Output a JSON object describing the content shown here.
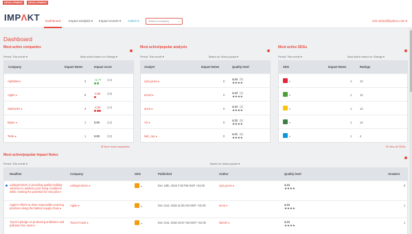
{
  "env": {
    "badge1": "DEVELOPMENT",
    "badge2": "DEVELOPMENT"
  },
  "header": {
    "logo_a": "IMP",
    "logo_b": "Λ",
    "logo_c": "KT",
    "nav": [
      "Dashboard",
      "Impact analysis ▾",
      "Impact scores ▾",
      "Admin ▾"
    ],
    "company_placeholder": "Select a company",
    "user_email": "seb.orlandi@yahoo.com ▾"
  },
  "page_title": "Dashboard",
  "companies": {
    "title": "Most active companies",
    "period": "Period: This month ▾",
    "sort": "Most active based on: Ratings ▾",
    "headers": [
      "Company",
      "Impact Notes",
      "Impact score"
    ],
    "rows": [
      {
        "name": "Alphabet ▾",
        "notes": "3",
        "score": "+1.77",
        "count": "(13)",
        "color": "green",
        "dots": [
          "#4caf50",
          "#4caf50"
        ]
      },
      {
        "name": "Apple ▾",
        "notes": "8",
        "score": "-0.56",
        "count": "(18)",
        "color": "red",
        "dots": [
          "#e53935"
        ]
      },
      {
        "name": "Starbucks ▾",
        "notes": "3",
        "score": "-2.25",
        "count": "(14)",
        "color": "red",
        "dots": [
          "#e53935",
          "#e53935",
          "#e53935"
        ]
      },
      {
        "name": "Bayer ▾",
        "notes": "1",
        "score": "0.00",
        "count": "(12)",
        "color": "black",
        "dots": []
      },
      {
        "name": "Tesla ▾",
        "notes": "1",
        "score": "0.00",
        "count": "(10)",
        "color": "black",
        "dots": []
      }
    ],
    "more": "More most companies"
  },
  "analysts": {
    "title": "Most active/popular analysts",
    "period": "Period: This month ▾",
    "sort": "Based on: Most popular ▾",
    "headers": [
      "Analyst",
      "Impact Notes",
      "Quality level"
    ],
    "rows": [
      {
        "name": "ryan.jones ▾",
        "notes": "0",
        "score": "4.44",
        "count": "(9)",
        "stars": "★★★★"
      },
      {
        "name": "arnud ▾",
        "notes": "0",
        "score": "4.33",
        "count": "(2)",
        "stars": "★★★★"
      },
      {
        "name": "anna ▾",
        "notes": "0",
        "score": "4.33",
        "count": "(3)",
        "stars": "★★★★"
      },
      {
        "name": "VS ▾",
        "notes": "0",
        "score": "4.33",
        "count": "(5)",
        "stars": "★★★★"
      },
      {
        "name": "liam_ray ▾",
        "notes": "0",
        "score": "4.31",
        "count": "(5)",
        "stars": "★★★★"
      }
    ]
  },
  "sdgs": {
    "title": "Most active SDGs",
    "period": "Period: This month ▾",
    "sort": "Most active based on: Ratings ▾",
    "headers": [
      "SDG",
      "Impact Notes",
      "Ratings"
    ],
    "rows": [
      {
        "color": "#e5243b",
        "notes": "1",
        "ratings": "12"
      },
      {
        "color": "#4c9f38",
        "notes": "1",
        "ratings": "12"
      },
      {
        "color": "#fcc30b",
        "notes": "1",
        "ratings": "12"
      },
      {
        "color": "#3f7e44",
        "notes": "1",
        "ratings": "12"
      },
      {
        "color": "#0a97d9",
        "notes": "1",
        "ratings": "4"
      }
    ],
    "more": "View all SDGs"
  },
  "notes": {
    "title": "Most active/popular Impact Notes",
    "period": "Period: This month ▾",
    "sort": "Based on: Most popular ▾",
    "headers": [
      "Headline",
      "Company",
      "SDG",
      "Published",
      "Author",
      "Quality level",
      "Answers"
    ],
    "rows": [
      {
        "headline": "LafargeHolcim is providing quality building solutions to address poor living conditions while creating the potential for new jobs ▾",
        "company": "LafargeHolcim ▾",
        "published": "Dec 19th, 2018 7:00 PM GMT +01:00",
        "author": "ryan.jones ▾",
        "score": "4.44",
        "stars": "★★★★",
        "answers": "0"
      },
      {
        "headline": "Apple's efforts to drive responsible sourcing practices along the battery supply chain ▾",
        "company": "Apple ▾",
        "published": "Dec 21st, 2018 11:05 AM GMT +01:00",
        "author": "anna ▾",
        "score": "4.33",
        "stars": "★★★★",
        "answers": "1"
      },
      {
        "headline": "Tyson's pledge on producing antibiotics and pollution free meat ▾",
        "company": "Tyson Foods ▾",
        "published": "Dec 21st, 2018 10:57 AM GMT +01:00",
        "author": "liamrel ▾",
        "score": "4.33",
        "stars": "★★★★",
        "answers": "1"
      }
    ]
  },
  "colors": {
    "accent": "#e8483b",
    "admin": "#2aa6c9",
    "table_header": "#dfe3e7"
  }
}
